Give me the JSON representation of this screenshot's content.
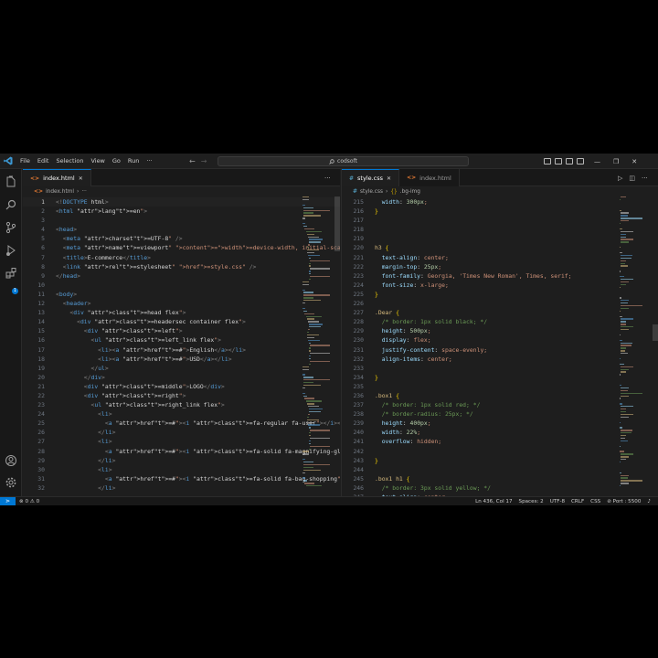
{
  "window": {
    "search": "codsoft"
  },
  "menu": [
    "File",
    "Edit",
    "Selection",
    "View",
    "Go",
    "Run",
    "···"
  ],
  "left_editor": {
    "tabs": [
      {
        "label": "index.html",
        "active": true
      }
    ],
    "breadcrumb": [
      "index.html",
      "›",
      "···"
    ],
    "lines": [
      {
        "n": "1",
        "code": "<!DOCTYPE html>"
      },
      {
        "n": "2",
        "code": "<html lang=\"en\">"
      },
      {
        "n": "3",
        "code": ""
      },
      {
        "n": "4",
        "code": "<head>"
      },
      {
        "n": "5",
        "code": "  <meta charset=\"UTF-8\" />"
      },
      {
        "n": "6",
        "code": "  <meta name=\"viewport\" content=\"width=device-width, initial-scale"
      },
      {
        "n": "7",
        "code": "  <title>E-commerce</title>"
      },
      {
        "n": "8",
        "code": "  <link rel=\"stylesheet\" href=\"style.css\" />"
      },
      {
        "n": "9",
        "code": "</head>"
      },
      {
        "n": "10",
        "code": ""
      },
      {
        "n": "11",
        "code": "<body>"
      },
      {
        "n": "12",
        "code": "  <header>"
      },
      {
        "n": "13",
        "code": "    <div class=\"head flex\">"
      },
      {
        "n": "14",
        "code": "      <div class=\"headersec container flex\">"
      },
      {
        "n": "15",
        "code": "        <div class=\"left\">"
      },
      {
        "n": "16",
        "code": "          <ul class=\"left_link flex\">"
      },
      {
        "n": "17",
        "code": "            <li><a href=\"#\">English</a></li>"
      },
      {
        "n": "18",
        "code": "            <li><a href=\"#\">USD</a></li>"
      },
      {
        "n": "19",
        "code": "          </ul>"
      },
      {
        "n": "20",
        "code": "        </div>"
      },
      {
        "n": "21",
        "code": "        <div class=\"middle\">LOGO</div>"
      },
      {
        "n": "22",
        "code": "        <div class=\"right\">"
      },
      {
        "n": "23",
        "code": "          <ul class=\"right_link flex\">"
      },
      {
        "n": "24",
        "code": "            <li>"
      },
      {
        "n": "25",
        "code": "              <a href=\"#\"><i class=\"fa-regular fa-user\"></i></a>"
      },
      {
        "n": "26",
        "code": "            </li>"
      },
      {
        "n": "27",
        "code": "            <li>"
      },
      {
        "n": "28",
        "code": "              <a href=\"#\"><i class=\"fa-solid fa-magnifying-glass\""
      },
      {
        "n": "29",
        "code": "            </li>"
      },
      {
        "n": "30",
        "code": "            <li>"
      },
      {
        "n": "31",
        "code": "              <a href=\"#\"><i class=\"fa-solid fa-bag-shopping\"></i"
      },
      {
        "n": "32",
        "code": "            </li>"
      }
    ]
  },
  "right_editor": {
    "tabs": [
      {
        "label": "style.css",
        "active": true
      },
      {
        "label": "index.html",
        "active": false
      }
    ],
    "breadcrumb": [
      "style.css",
      "›",
      "{}",
      ".bg-img"
    ],
    "lines": [
      {
        "n": "215",
        "code": "  width: 300px;"
      },
      {
        "n": "216",
        "code": "}"
      },
      {
        "n": "217",
        "code": ""
      },
      {
        "n": "218",
        "code": ""
      },
      {
        "n": "219",
        "code": ""
      },
      {
        "n": "220",
        "code": "h3 {"
      },
      {
        "n": "221",
        "code": "  text-align: center;"
      },
      {
        "n": "222",
        "code": "  margin-top: 25px;"
      },
      {
        "n": "223",
        "code": "  font-family: Georgia, 'Times New Roman', Times, serif;"
      },
      {
        "n": "224",
        "code": "  font-size: x-large;"
      },
      {
        "n": "225",
        "code": "}"
      },
      {
        "n": "226",
        "code": ""
      },
      {
        "n": "227",
        "code": ".Dear {"
      },
      {
        "n": "228",
        "code": "  /* border: 1px solid black; */"
      },
      {
        "n": "229",
        "code": "  height: 500px;"
      },
      {
        "n": "230",
        "code": "  display: flex;"
      },
      {
        "n": "231",
        "code": "  justify-content: space-evenly;"
      },
      {
        "n": "232",
        "code": "  align-items: center;"
      },
      {
        "n": "233",
        "code": ""
      },
      {
        "n": "234",
        "code": "}"
      },
      {
        "n": "235",
        "code": ""
      },
      {
        "n": "236",
        "code": ".box1 {"
      },
      {
        "n": "237",
        "code": "  /* border: 1px solid red; */"
      },
      {
        "n": "238",
        "code": "  /* border-radius: 25px; */"
      },
      {
        "n": "239",
        "code": "  height: 400px;"
      },
      {
        "n": "240",
        "code": "  width: 22%;"
      },
      {
        "n": "241",
        "code": "  overflow: hidden;"
      },
      {
        "n": "242",
        "code": ""
      },
      {
        "n": "243",
        "code": "}"
      },
      {
        "n": "244",
        "code": ""
      },
      {
        "n": "245",
        "code": ".box1 h1 {"
      },
      {
        "n": "246",
        "code": "  /* border: 3px solid yellow; */"
      },
      {
        "n": "247",
        "code": "  text-align: center;"
      }
    ]
  },
  "status_bar": {
    "left": "⊗ 0 ⚠ 0",
    "right": [
      "Ln 436, Col 17",
      "Spaces: 2",
      "UTF-8",
      "CRLF",
      "CSS",
      "⊘ Port : 5500"
    ]
  },
  "colors": {
    "accent": "#0078d4",
    "editor_bg": "#1e1e1e",
    "chrome_bg": "#181818"
  }
}
